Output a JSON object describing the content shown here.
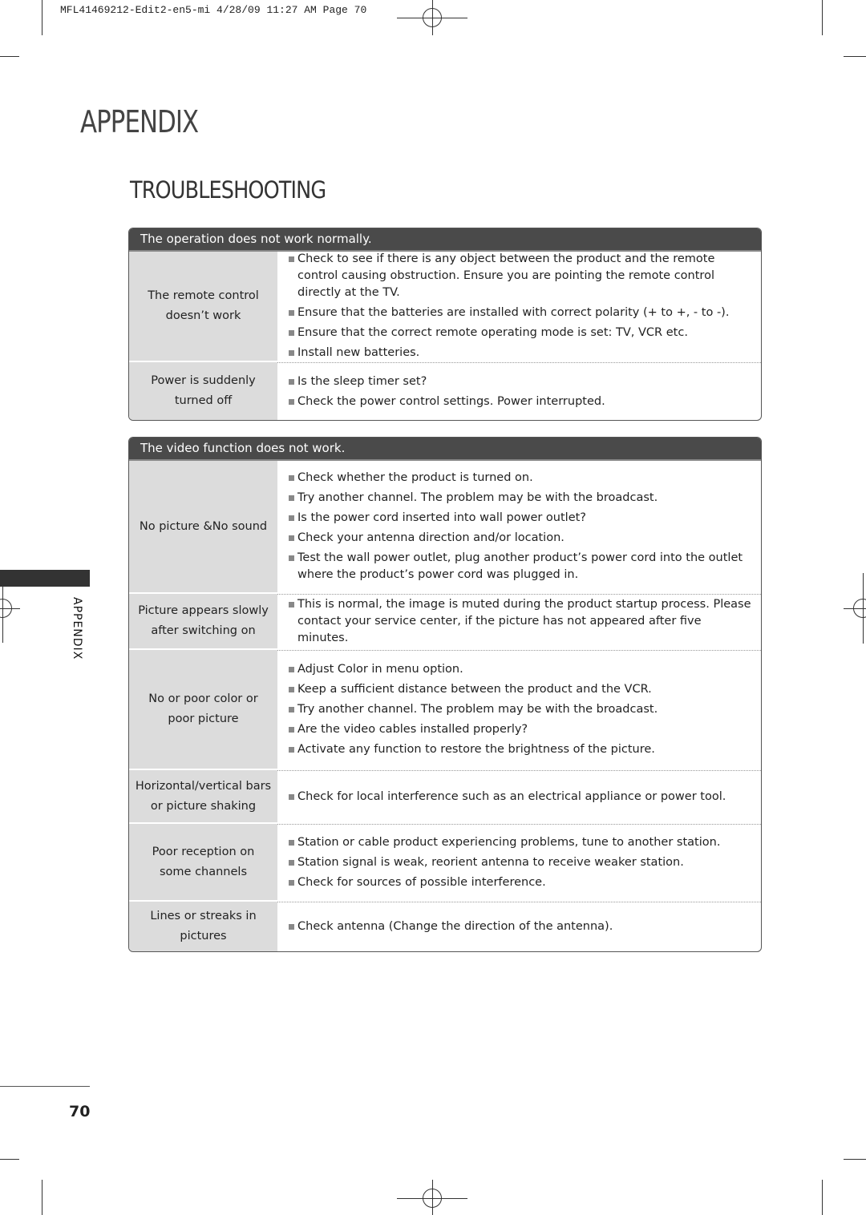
{
  "slug": "MFL41469212-Edit2-en5-mi  4/28/09 11:27 AM  Page 70",
  "chapter": "APPENDIX",
  "section": "TROUBLESHOOTING",
  "side_label": "APPENDIX",
  "page_number": "70",
  "tables": [
    {
      "header": "The operation does not work normally.",
      "rows": [
        {
          "label": "The remote control doesn’t work",
          "items": [
            "Check to see if there is any object between the product and the remote control causing obstruction. Ensure you are pointing the remote control directly at the TV.",
            "Ensure that the batteries are installed with correct polarity (+ to +, - to -).",
            "Ensure that the correct remote operating mode is set: TV, VCR etc.",
            "Install new batteries."
          ]
        },
        {
          "label": "Power is suddenly turned off",
          "items": [
            "Is the sleep timer set?",
            "Check the power control settings. Power interrupted."
          ]
        }
      ]
    },
    {
      "header": "The video function does not work.",
      "rows": [
        {
          "label": "No picture &No sound",
          "items": [
            "Check whether the product is turned on.",
            "Try another channel. The problem may be with the broadcast.",
            "Is the power cord inserted into wall power outlet?",
            "Check your antenna direction and/or location.",
            "Test the wall power outlet, plug another product’s power cord into the outlet where the product’s power cord was plugged in."
          ]
        },
        {
          "label": "Picture appears slowly after switching on",
          "items": [
            "This is normal, the image is muted during the product startup process. Please contact your service center, if the picture has not appeared after five minutes."
          ]
        },
        {
          "label": "No or poor color or poor picture",
          "items": [
            "Adjust Color in menu option.",
            "Keep a sufficient distance between the product and the VCR.",
            "Try another channel. The problem may be with the broadcast.",
            "Are the video cables installed properly?",
            "Activate any function to restore the brightness of the picture."
          ]
        },
        {
          "label": "Horizontal/vertical bars or picture shaking",
          "items": [
            "Check for local interference such as an electrical appliance or power tool."
          ]
        },
        {
          "label": "Poor reception on some channels",
          "items": [
            "Station or cable product experiencing problems, tune to another station.",
            "Station signal is weak, reorient antenna to receive weaker station.",
            "Check for sources of possible interference."
          ]
        },
        {
          "label": "Lines or streaks in pictures",
          "items": [
            "Check antenna (Change the direction of the antenna)."
          ]
        }
      ]
    }
  ]
}
